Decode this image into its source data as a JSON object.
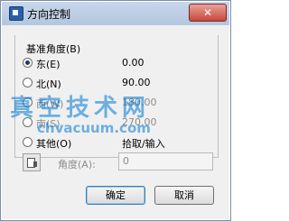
{
  "window": {
    "title": "方向控制",
    "close_glyph": "✕"
  },
  "group": {
    "title": "基准角度(B)"
  },
  "options": [
    {
      "label": "东(E)",
      "value": "0.00",
      "checked": true,
      "disabled": false
    },
    {
      "label": "北(N)",
      "value": "90.00",
      "checked": false,
      "disabled": false
    },
    {
      "label": "西(W)",
      "value": "180.00",
      "checked": false,
      "disabled": true
    },
    {
      "label": "南(S)",
      "value": "270.00",
      "checked": false,
      "disabled": true
    },
    {
      "label": "其他(O)",
      "value": "拾取/输入",
      "checked": false,
      "disabled": false
    }
  ],
  "angle": {
    "label": "角度(A):",
    "value": "0"
  },
  "buttons": {
    "ok": "确定",
    "cancel": "取消"
  },
  "watermark": {
    "text": "真空技术网",
    "url": "chvacuum.com"
  }
}
